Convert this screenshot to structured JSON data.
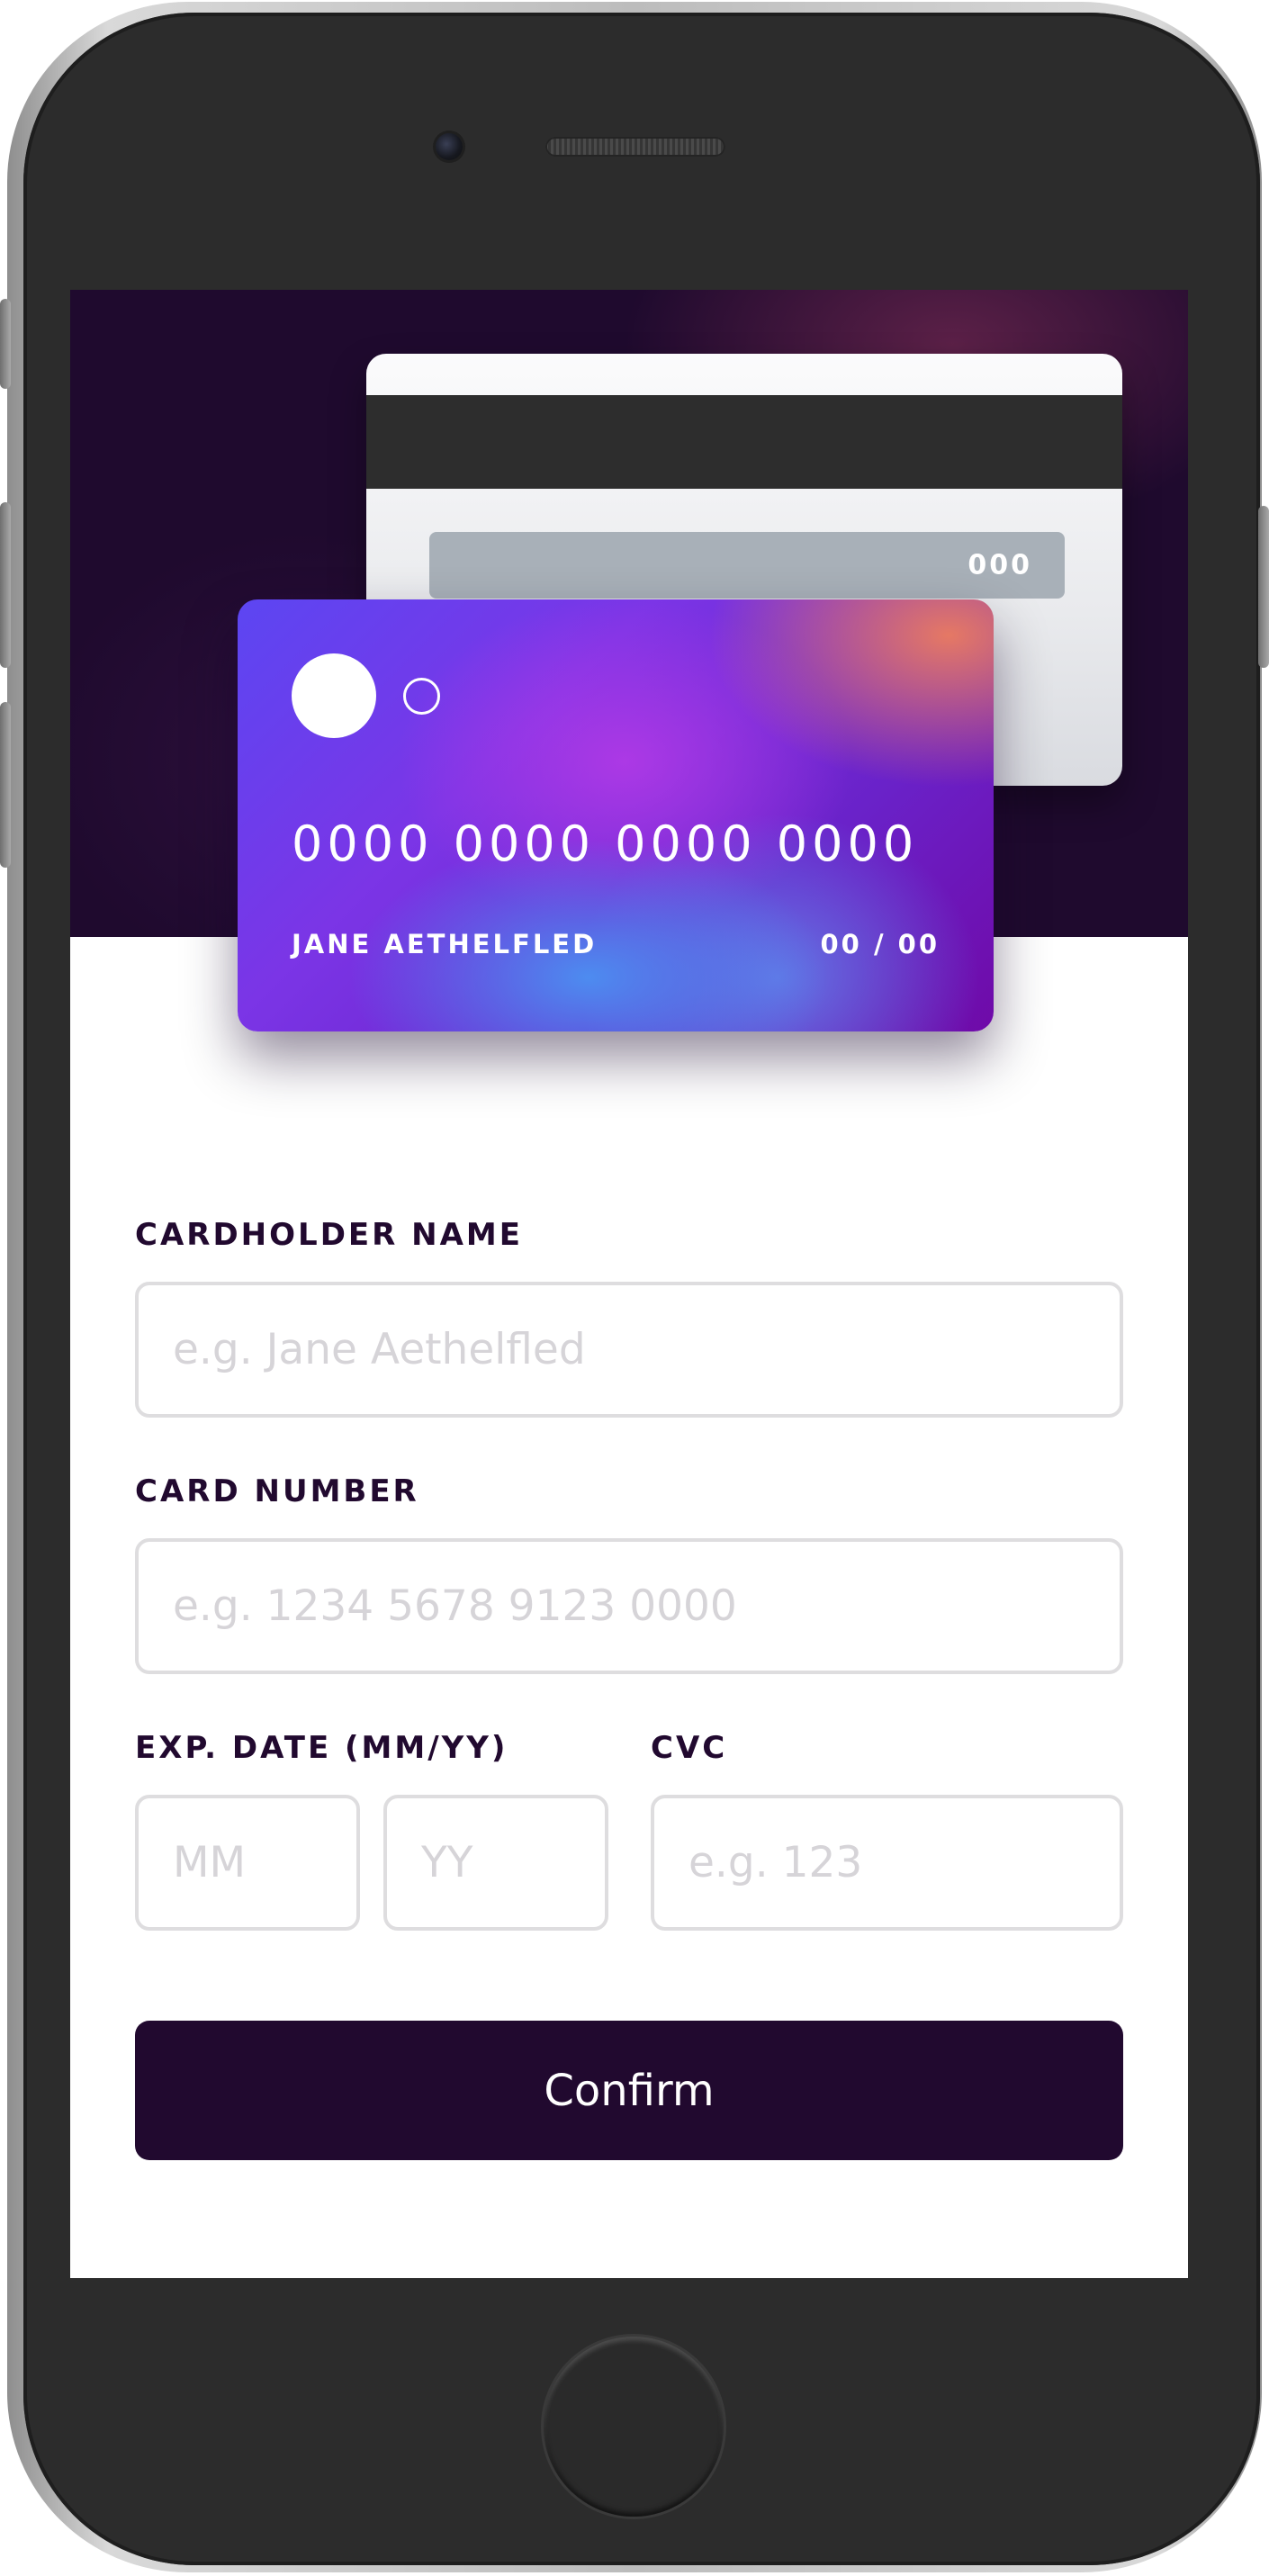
{
  "card_back": {
    "cvc": "000"
  },
  "card_front": {
    "number": "0000 0000 0000 0000",
    "holder_name": "JANE AETHELFLED",
    "expiry": "00 / 00"
  },
  "form": {
    "name": {
      "label": "CARDHOLDER NAME",
      "placeholder": "e.g. Jane Aethelfled",
      "value": ""
    },
    "number": {
      "label": "CARD NUMBER",
      "placeholder": "e.g. 1234 5678 9123 0000",
      "value": ""
    },
    "expiry": {
      "label": "EXP. DATE (MM/YY)",
      "month_placeholder": "MM",
      "year_placeholder": "YY"
    },
    "cvc": {
      "label": "CVC",
      "placeholder": "e.g. 123"
    },
    "confirm_label": "Confirm"
  },
  "colors": {
    "primary_dark": "#21092f",
    "input_border": "#dedddf",
    "placeholder": "#d6d4d8",
    "card_gradient_start": "#5c46f2",
    "card_gradient_end": "#6f0aa8"
  }
}
